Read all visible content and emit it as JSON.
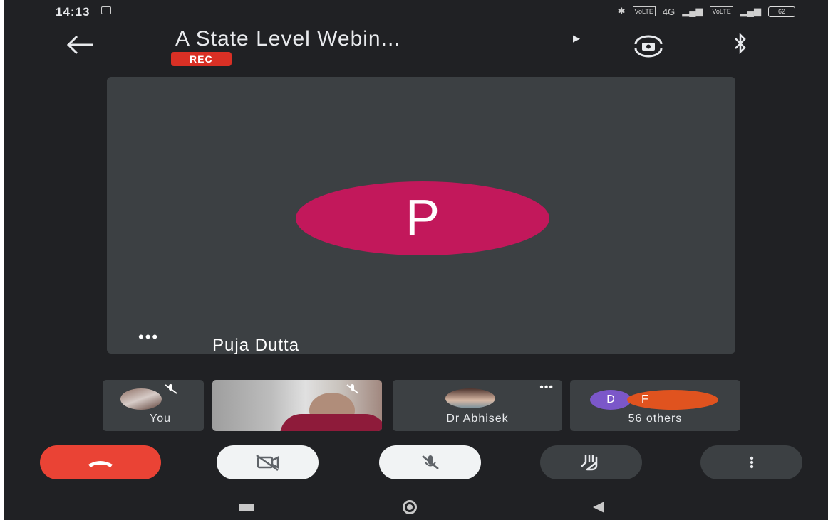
{
  "status_bar": {
    "time": "14:13",
    "sim1": "VoLTE",
    "network": "4G",
    "sim2": "VoLTE",
    "battery": "62"
  },
  "header": {
    "title": "A State Level Webin...",
    "rec_label": "REC"
  },
  "main_tile": {
    "avatar_letter": "P",
    "participant_name": "Puja Dutta",
    "avatar_color": "#c2185b"
  },
  "participants": {
    "you_label": "You",
    "dr_label": "Dr Abhisek",
    "others_label": "56 others",
    "others_avatar_1": "D",
    "others_avatar_2": "F"
  },
  "colors": {
    "background": "#202124",
    "tile": "#3c4043",
    "end_call": "#ea4335",
    "rec": "#d93025"
  },
  "icons": [
    "back-arrow-icon",
    "play-icon",
    "camera-switch-icon",
    "bluetooth-icon",
    "more-dots-icon",
    "mic-off-icon",
    "end-call-icon",
    "camera-off-icon",
    "hand-raise-icon",
    "more-vert-icon"
  ]
}
